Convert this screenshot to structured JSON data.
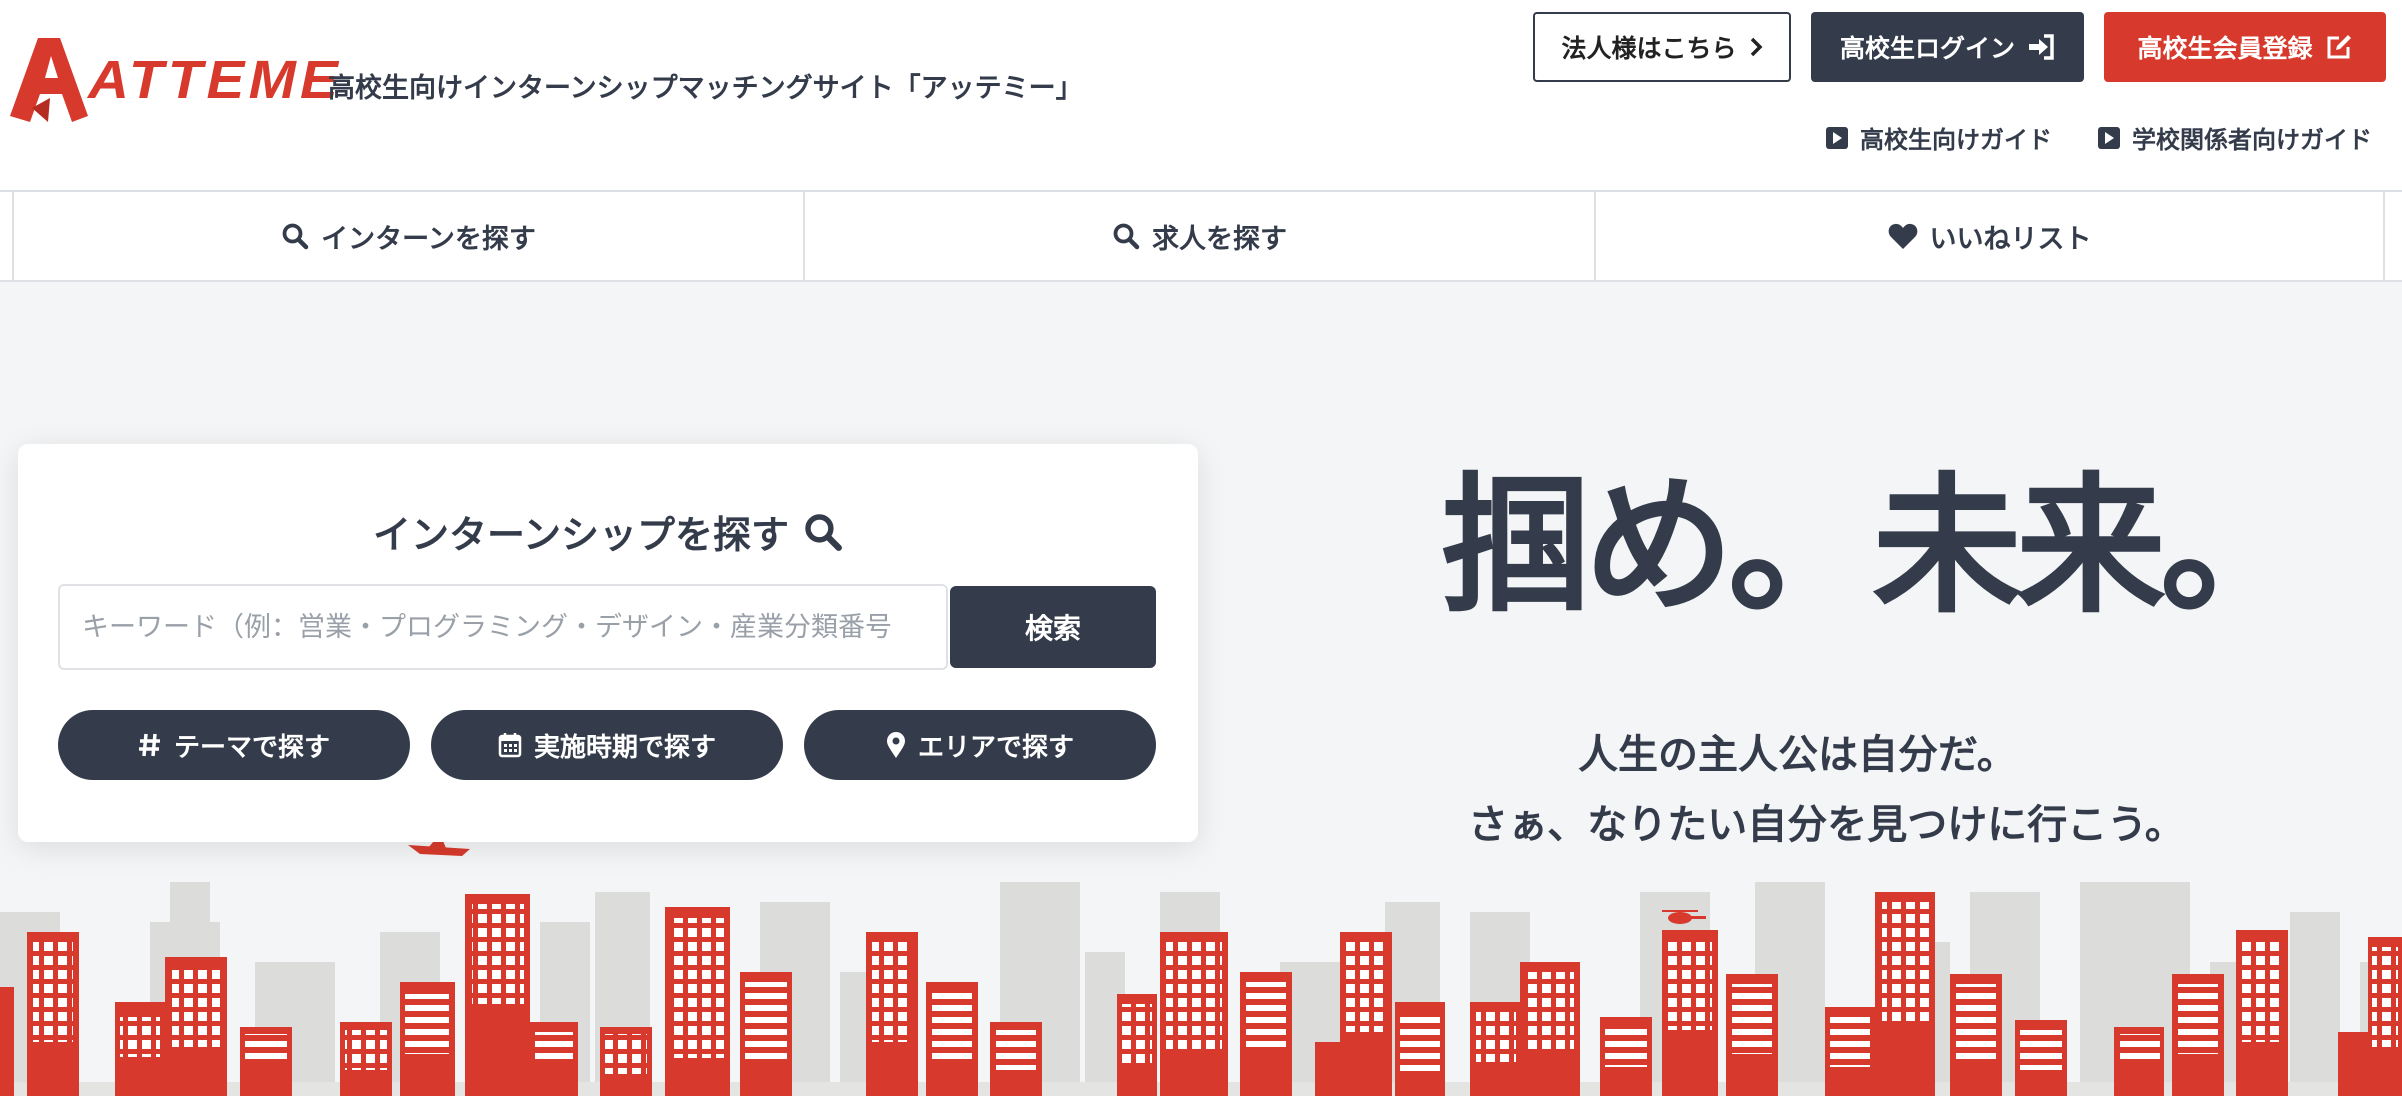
{
  "header": {
    "logo_text": "ATTEME",
    "tagline": "高校生向けインターンシップマッチングサイト「アッテミー」",
    "buttons": {
      "corporate": "法人様はこちら",
      "login": "高校生ログイン",
      "register": "高校生会員登録"
    },
    "guides": {
      "student": "高校生向けガイド",
      "school": "学校関係者向けガイド"
    }
  },
  "nav": {
    "items": [
      {
        "label": "インターンを探す",
        "icon": "search-icon"
      },
      {
        "label": "求人を探す",
        "icon": "search-icon"
      },
      {
        "label": "いいねリスト",
        "icon": "heart-icon"
      }
    ]
  },
  "search": {
    "title": "インターンシップを探す",
    "placeholder": "キーワード（例：営業・プログラミング・デザイン・産業分類番号",
    "submit": "検索",
    "filters": [
      {
        "label": "テーマで探す",
        "icon": "hash-icon"
      },
      {
        "label": "実施時期で探す",
        "icon": "calendar-icon"
      },
      {
        "label": "エリアで探す",
        "icon": "map-pin-icon"
      }
    ]
  },
  "hero": {
    "catch": "掴め。未来。",
    "sub1": "人生の主人公は自分だ。",
    "sub2": "さぁ、なりたい自分を見つけに行こう。"
  },
  "colors": {
    "navy": "#343c4b",
    "red": "#d73a2c",
    "bg": "#f4f5f6",
    "building_grey": "#dcdcda"
  }
}
